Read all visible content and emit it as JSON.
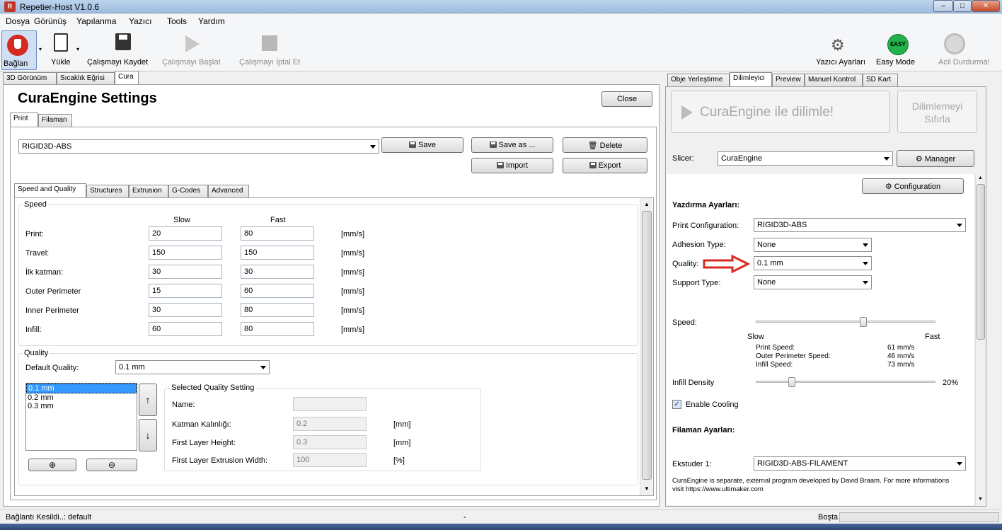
{
  "window": {
    "title": "Repetier-Host V1.0.6",
    "app_icon": "R"
  },
  "menubar": {
    "items": [
      "Dosya",
      "Görünüş",
      "Yapılanma",
      "Yazıcı",
      "Tools",
      "Yardım"
    ]
  },
  "toolbar": {
    "connect": "Bağlan",
    "load": "Yükle",
    "save_job": "Çalışmayı Kaydet",
    "start_job": "Çalışmayı Başlat",
    "cancel_job": "Çalışmayı İptal Et",
    "printer_settings": "Yazıcı Ayarları",
    "easy_mode": "Easy Mode",
    "easy_badge": "EASY",
    "emergency_stop": "Acil Durdurma!"
  },
  "left_tabs": [
    "3D Görünüm",
    "Sıcaklık Eğrisi",
    "Cura"
  ],
  "cura": {
    "title": "CuraEngine Settings",
    "close": "Close",
    "sub_tabs": [
      "Print",
      "Filaman"
    ],
    "profile": "RIGID3D-ABS",
    "buttons": {
      "save": "Save",
      "save_as": "Save as ...",
      "delete": "Delete",
      "import": "Import",
      "export": "Export"
    },
    "setting_tabs": [
      "Speed and Quality",
      "Structures",
      "Extrusion",
      "G-Codes",
      "Advanced"
    ],
    "speed": {
      "group": "Speed",
      "slow_header": "Slow",
      "fast_header": "Fast",
      "rows": [
        {
          "label": "Print:",
          "slow": "20",
          "fast": "80",
          "unit": "[mm/s]"
        },
        {
          "label": "Travel:",
          "slow": "150",
          "fast": "150",
          "unit": "[mm/s]"
        },
        {
          "label": "İlk katman:",
          "slow": "30",
          "fast": "30",
          "unit": "[mm/s]"
        },
        {
          "label": "Outer Perimeter",
          "slow": "15",
          "fast": "60",
          "unit": "[mm/s]"
        },
        {
          "label": "Inner Perimeter",
          "slow": "30",
          "fast": "80",
          "unit": "[mm/s]"
        },
        {
          "label": "Infill:",
          "slow": "60",
          "fast": "80",
          "unit": "[mm/s]"
        }
      ]
    },
    "quality": {
      "group": "Quality",
      "default_label": "Default Quality:",
      "default_value": "0.1 mm",
      "list": [
        "0.1 mm",
        "0.2 mm",
        "0.3 mm"
      ],
      "selected_group": "Selected Quality Setting",
      "name_label": "Name:",
      "name_value": "",
      "layer_label": "Katman Kalınlığı:",
      "layer_value": "0.2",
      "layer_unit": "[mm]",
      "first_height_label": "First Layer Height:",
      "first_height_value": "0.3",
      "first_height_unit": "[mm]",
      "first_width_label": "First Layer Extrusion Width:",
      "first_width_value": "100",
      "first_width_unit": "[%]"
    }
  },
  "right_tabs": [
    "Obje Yerleştirme",
    "Dilimleyici",
    "Preview",
    "Manuel Kontrol",
    "SD Kart"
  ],
  "slicer": {
    "slice_button": "CuraEngine ile dilimle!",
    "reset_button": "Dilimlemeyi Sıfırla",
    "slicer_label": "Slicer:",
    "slicer_value": "CuraEngine",
    "manager": "Manager",
    "configuration": "Configuration",
    "print_settings_title": "Yazdırma Ayarları:",
    "print_config_label": "Print Configuration:",
    "print_config_value": "RIGID3D-ABS",
    "adhesion_label": "Adhesion Type:",
    "adhesion_value": "None",
    "quality_label": "Quality:",
    "quality_value": "0.1 mm",
    "support_label": "Support Type:",
    "support_value": "None",
    "speed_label": "Speed:",
    "speed_slow": "Slow",
    "speed_fast": "Fast",
    "speed_level": 0.6,
    "print_speed_label": "Print Speed:",
    "print_speed_value": "61 mm/s",
    "outer_speed_label": "Outer Perimeter Speed:",
    "outer_speed_value": "46 mm/s",
    "infill_speed_label": "Infill Speed:",
    "infill_speed_value": "73 mm/s",
    "infill_label": "Infill Density",
    "infill_value": "20%",
    "infill_level": 0.2,
    "cooling_label": "Enable Cooling",
    "filament_title": "Filaman Ayarları:",
    "extruder_label": "Ekstuder 1:",
    "extruder_value": "RIGID3D-ABS-FILAMENT",
    "footer": "CuraEngine is separate, external program developed by David Braam. For more informations visit https://www.ultimaker.com"
  },
  "status": {
    "left": "Bağlantı Kesildi..: default",
    "middle": "-",
    "right": "Boşta"
  },
  "colors": {
    "accent_red": "#d42a20",
    "easy_green": "#22b14c",
    "selection_blue": "#3399ff"
  }
}
